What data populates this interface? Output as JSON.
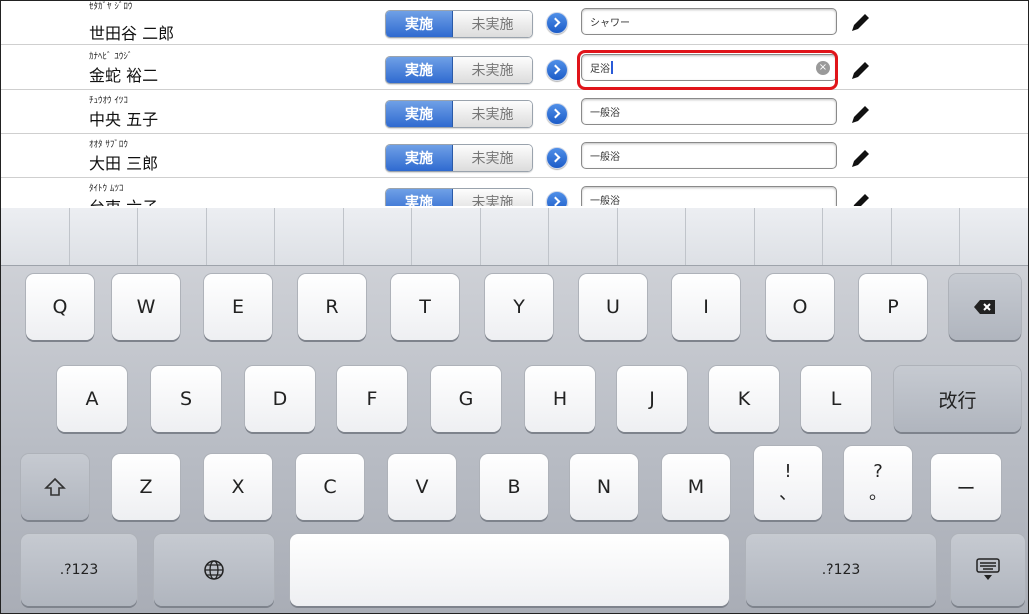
{
  "list": {
    "rows": [
      {
        "kana": "ｾﾀｶﾞﾔ ｼﾞﾛｳ",
        "name": "世田谷 二郎",
        "done": "実施",
        "not_done": "未実施",
        "field": "シャワー"
      },
      {
        "kana": "ｶﾅﾍﾋﾞ ﾕｳｼﾞ",
        "name": "金蛇 裕二",
        "done": "実施",
        "not_done": "未実施",
        "field": "足浴"
      },
      {
        "kana": "ﾁｭｳｵｳ ｲﾂｺ",
        "name": "中央 五子",
        "done": "実施",
        "not_done": "未実施",
        "field": "一般浴"
      },
      {
        "kana": "ｵｵﾀ ｻﾌﾞﾛｳ",
        "name": "大田 三郎",
        "done": "実施",
        "not_done": "未実施",
        "field": "一般浴"
      },
      {
        "kana": "ﾀｲﾄｳ ﾑﾂｺ",
        "name": "台東 六子",
        "done": "実施",
        "not_done": "未実施",
        "field": "一般浴"
      }
    ],
    "active_row_index": 1
  },
  "keyboard": {
    "row1": [
      "Q",
      "W",
      "E",
      "R",
      "T",
      "Y",
      "U",
      "I",
      "O",
      "P"
    ],
    "row2": [
      "A",
      "S",
      "D",
      "F",
      "G",
      "H",
      "J",
      "K",
      "L"
    ],
    "return_label": "改行",
    "row3": [
      "Z",
      "X",
      "C",
      "V",
      "B",
      "N",
      "M"
    ],
    "punct1_top": "!",
    "punct1_bottom": "、",
    "punct2_top": "?",
    "punct2_bottom": "。",
    "dash": "ー",
    "numbers_left": ".?123",
    "numbers_right": ".?123",
    "icons": {
      "shift": "shift-icon",
      "backspace": "backspace-icon",
      "globe": "globe-icon",
      "hide": "keyboard-hide-icon"
    }
  },
  "colors": {
    "accent": "#2f6ad0",
    "highlight": "#e0141a"
  }
}
